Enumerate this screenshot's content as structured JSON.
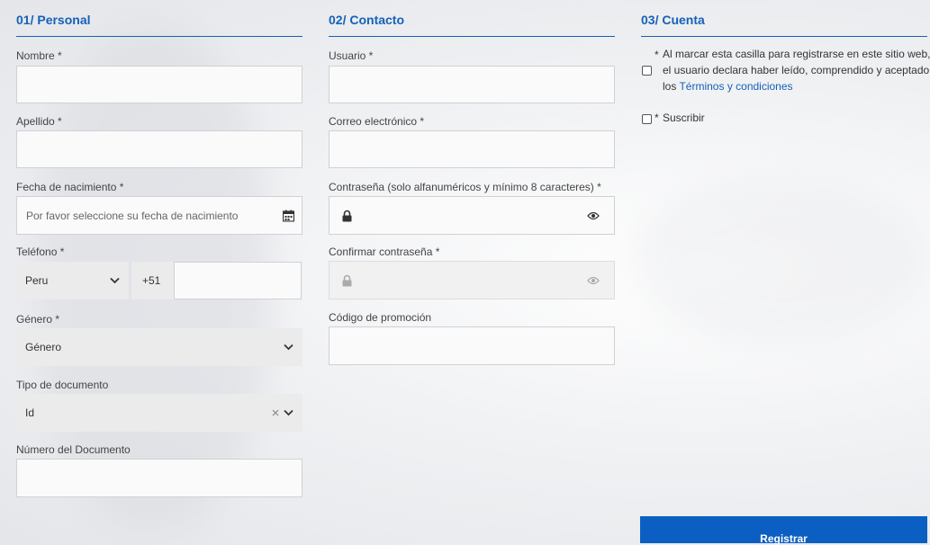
{
  "personal": {
    "title": "01/ Personal",
    "nombre_label": "Nombre *",
    "apellido_label": "Apellido *",
    "fecha_label": "Fecha de nacimiento *",
    "fecha_placeholder": "Por favor seleccione su fecha de nacimiento",
    "telefono_label": "Teléfono *",
    "country_value": "Peru",
    "prefix_value": "+51",
    "genero_label": "Género *",
    "genero_value": "Género",
    "tipo_label": "Tipo de documento",
    "tipo_value": "Id",
    "numero_label": "Número del Documento"
  },
  "contacto": {
    "title": "02/ Contacto",
    "usuario_label": "Usuario *",
    "correo_label": "Correo electrónico *",
    "password_label": "Contraseña (solo alfanuméricos y mínimo 8 caracteres) *",
    "confirm_label": "Confirmar contraseña *",
    "promo_label": "Código de promoción"
  },
  "cuenta": {
    "title": "03/ Cuenta",
    "terms_star": "*",
    "terms_line1": "Al marcar esta casilla para registrarse en este sitio web,",
    "terms_line2": "el usuario declara haber leído, comprendido y aceptado",
    "terms_line3_prefix": "los",
    "terms_link": "Términos y condiciones",
    "subscribe_star": "*",
    "subscribe_label": "Suscribir"
  },
  "register_button": "Registrar",
  "colors": {
    "accent": "#1561b8",
    "button": "#0c5fc2"
  }
}
